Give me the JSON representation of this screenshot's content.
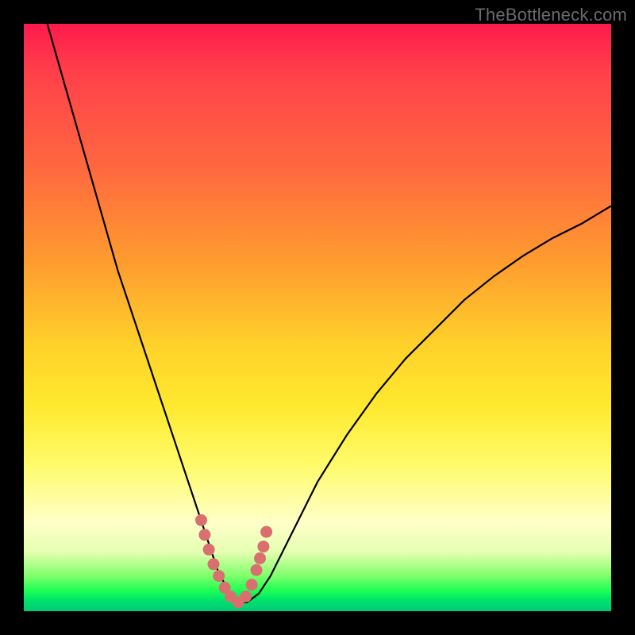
{
  "watermark": "TheBottleneck.com",
  "chart_data": {
    "type": "line",
    "title": "",
    "xlabel": "",
    "ylabel": "",
    "xlim": [
      0,
      100
    ],
    "ylim": [
      0,
      100
    ],
    "grid": false,
    "series": [
      {
        "name": "bottleneck-curve",
        "x": [
          4,
          6,
          8,
          10,
          12,
          14,
          16,
          18,
          20,
          22,
          24,
          26,
          27,
          28,
          29,
          30,
          31,
          32,
          33,
          34,
          35,
          36.5,
          38,
          40,
          42,
          44,
          46,
          48,
          50,
          55,
          60,
          65,
          70,
          75,
          80,
          85,
          90,
          95,
          100
        ],
        "y": [
          100,
          93,
          86,
          79,
          72,
          65,
          58,
          52,
          46,
          40,
          34,
          28,
          25,
          22,
          19,
          16,
          13,
          10,
          7,
          5,
          3,
          1.5,
          1.5,
          3,
          6,
          10,
          14,
          18,
          22,
          30,
          37,
          43,
          48,
          53,
          57,
          60.5,
          63.5,
          66,
          69
        ]
      },
      {
        "name": "highlight-segment",
        "x": [
          30.2,
          30.8,
          31.5,
          32.3,
          33.2,
          34.2,
          35.2,
          36.5,
          37.8,
          38.8,
          39.6,
          40.2,
          40.8,
          41.3
        ],
        "y": [
          15.5,
          13.0,
          10.5,
          8.0,
          6.0,
          4.0,
          2.5,
          1.5,
          2.5,
          4.5,
          7.0,
          9.0,
          11.0,
          13.5
        ]
      }
    ],
    "gradient_stops": [
      {
        "pct": 0,
        "color": "#ff1a4d"
      },
      {
        "pct": 25,
        "color": "#ff6a3f"
      },
      {
        "pct": 55,
        "color": "#ffd22a"
      },
      {
        "pct": 85,
        "color": "#ffffc8"
      },
      {
        "pct": 96,
        "color": "#1dff55"
      },
      {
        "pct": 100,
        "color": "#00c878"
      }
    ]
  }
}
